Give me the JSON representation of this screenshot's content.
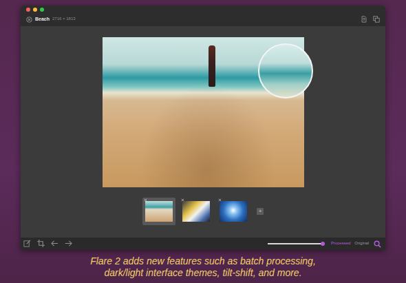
{
  "window": {
    "title": "Beach",
    "dimensions": "2716 × 1813"
  },
  "thumbnails": [
    {
      "selected": true
    },
    {
      "selected": false
    },
    {
      "selected": false
    }
  ],
  "add_button": "+",
  "view_slider": {
    "level": 0.96
  },
  "view_modes": [
    {
      "label": "Processed",
      "selected": true
    },
    {
      "label": "Original",
      "selected": false
    }
  ],
  "caption": {
    "lines": [
      "Flare 2 adds new features such as batch processing,",
      "dark/light interface themes, tilt-shift, and more."
    ]
  }
}
